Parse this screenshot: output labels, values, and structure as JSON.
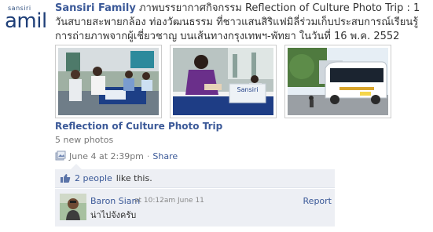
{
  "brand": {
    "small_text": "sansiri",
    "big_text": "amil"
  },
  "story": {
    "actor": "Sansiri Family",
    "text": "ภาพบรรยากาศกิจกรรม Reflection of Culture Photo Trip : 1 วันสบายสะพายกล้อง ท่องวัฒนธรรม ที่ชาวแสนสิริแฟมิลี่ร่วมเก็บประสบการณ์เรียนรู้การถ่ายภาพจากผู้เชี่ยวชาญ บนเส้นทางกรุงเทพฯ-พัทยา ในวันที่ 16 พ.ค. 2552"
  },
  "photos": [
    {
      "name": "photo-registration-desk",
      "sign_text": ""
    },
    {
      "name": "photo-sign-in-table",
      "sign_text": "Sansiri"
    },
    {
      "name": "photo-tour-bus",
      "sign_text": ""
    }
  ],
  "album": {
    "title": "Reflection of Culture Photo Trip",
    "count_text": "5 new photos"
  },
  "meta": {
    "time": "June 4 at 2:39pm",
    "separator": "·",
    "share": "Share"
  },
  "likes": {
    "count_link": "2 people",
    "suffix": "like this."
  },
  "comment": {
    "author": "Baron Siam",
    "time": "at 10:12am June 11",
    "text": "น่าไปจังครับ",
    "report": "Report"
  },
  "colors": {
    "link": "#3b5998",
    "panel": "#edeff4",
    "muted": "#777777"
  }
}
